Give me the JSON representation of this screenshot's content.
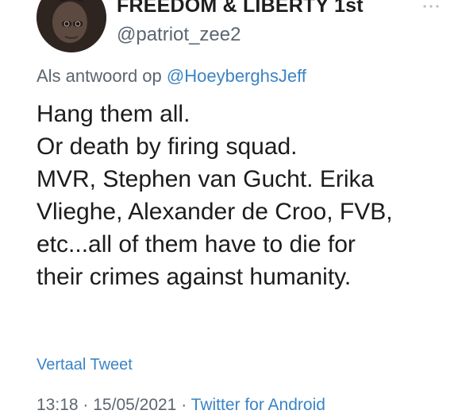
{
  "author": {
    "display_name": "FREEDOM & LIBERTY 1st",
    "handle": "@patriot_zee2"
  },
  "reply": {
    "prefix": "Als antwoord op",
    "mention": "@HoeyberghsJeff"
  },
  "tweet": {
    "lines": [
      "Hang them all.",
      "Or death by firing squad.",
      "MVR, Stephen van Gucht. Erika",
      "Vlieghe,  Alexander de Croo,  FVB,",
      "etc...all of them have to die for",
      "their crimes against humanity."
    ]
  },
  "actions": {
    "translate_label": "Vertaal Tweet",
    "more_icon": "ellipsis-icon"
  },
  "meta": {
    "time": "13:18",
    "separator": "·",
    "date": "15/05/2021",
    "source": "Twitter for Android"
  },
  "colors": {
    "link": "#3b84c4",
    "secondary_text": "#5b6670",
    "primary_text": "#1c1c1c"
  }
}
